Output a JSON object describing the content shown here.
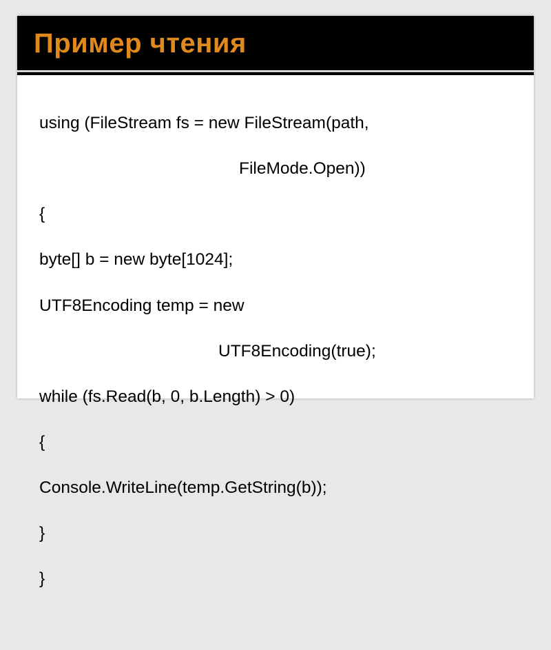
{
  "title": "Пример чтения",
  "code": {
    "l1": "using (FileStream fs = new FileStream(path,",
    "l2": "FileMode.Open))",
    "l3": "{",
    "l4": "byte[] b = new byte[1024];",
    "l5": "UTF8Encoding temp = new",
    "l6": "UTF8Encoding(true);",
    "l7": "while (fs.Read(b, 0, b.Length) > 0)",
    "l8": "{",
    "l9": "Console.WriteLine(temp.GetString(b));",
    "l10": "}",
    "l11": "}"
  }
}
